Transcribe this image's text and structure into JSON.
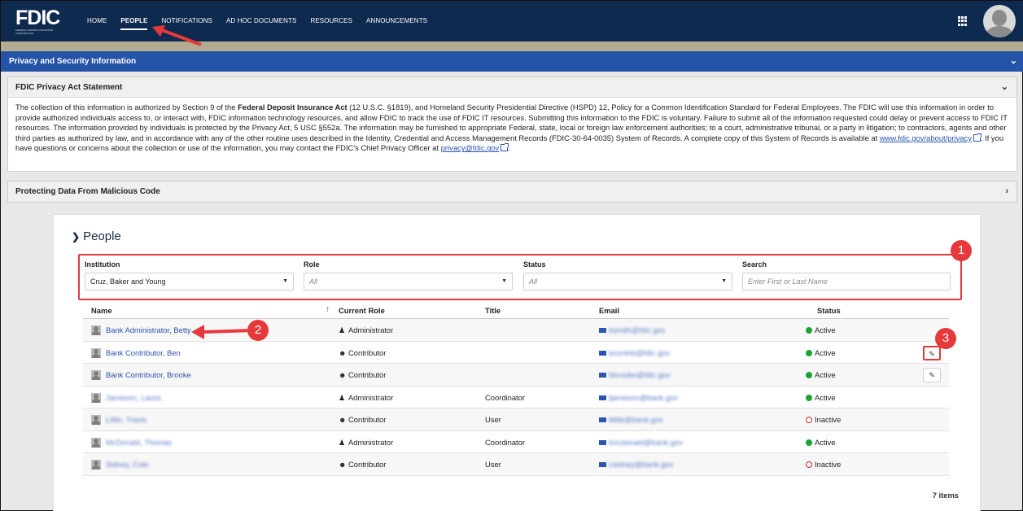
{
  "nav": {
    "logo_text": "FDIC",
    "logo_subtext": "FEDERAL DEPOSIT INSURANCE CORPORATION",
    "items": [
      "HOME",
      "PEOPLE",
      "NOTIFICATIONS",
      "AD HOC DOCUMENTS",
      "RESOURCES",
      "ANNOUNCEMENTS"
    ],
    "active": "PEOPLE"
  },
  "banner": {
    "title": "Privacy and Security Information"
  },
  "privacy": {
    "title": "FDIC Privacy Act Statement",
    "p1": "The collection of this information is authorized by Section 9 of the ",
    "p1_bold": "Federal Deposit Insurance Act",
    "p2": " (12 U.S.C. §1819), and Homeland Security Presidential Directive (HSPD) 12, Policy for a Common Identification Standard for Federal Employees.  The FDIC will use this information in order to provide authorized individuals access to, or interact with, FDIC information technology resources, and allow FDIC to track the use of FDIC IT resources. Submitting this information to the FDIC is voluntary.  Failure to submit all of the information requested could delay or prevent access to FDIC IT resources. The information provided by individuals is protected by the Privacy Act, 5 USC §552a.  The information may be furnished to appropriate Federal, state, local or foreign law enforcement authorities; to a court, administrative tribunal, or a party in litigation; to contractors, agents and other third parties as authorized by law, and in accordance with any of the other routine uses described in the Identity, Credential and Access Management Records (FDIC-30-64-0035) System of Records.  A complete copy of this System of Records is available at ",
    "link1": "www.fdic.gov/about/privacy",
    "p3": ". If you have questions or concerns about the collection or use of the information, you may contact the FDIC's Chief Privacy Officer at ",
    "link2": "privacy@fdic.gov",
    "p4": "."
  },
  "malicious": {
    "title": "Protecting Data From Malicious Code"
  },
  "people": {
    "title": "People",
    "filters": {
      "institution_label": "Institution",
      "institution_value": "Cruz, Baker and Young",
      "role_label": "Role",
      "role_value": "All",
      "status_label": "Status",
      "status_value": "All",
      "search_label": "Search",
      "search_placeholder": "Enter First or Last Name"
    },
    "columns": {
      "name": "Name",
      "role": "Current Role",
      "title": "Title",
      "email": "Email",
      "status": "Status"
    },
    "rows": [
      {
        "name": "Bank Administrator, Betty",
        "role": "Administrator",
        "role_icon": "users-icon",
        "title": "",
        "email": "bsmith@fdic.gov",
        "status": "Active",
        "edit": false,
        "blurred": false
      },
      {
        "name": "Bank Contributor, Ben",
        "role": "Contributor",
        "role_icon": "user-icon",
        "title": "",
        "email": "bcontrib@fdic.gov",
        "status": "Active",
        "edit": true,
        "blurred": false
      },
      {
        "name": "Bank Contributor, Brooke",
        "role": "Contributor",
        "role_icon": "user-icon",
        "title": "",
        "email": "bbrooke@fdic.gov",
        "status": "Active",
        "edit": true,
        "blurred": false
      },
      {
        "name": "Jameson, Laura",
        "role": "Administrator",
        "role_icon": "users-icon",
        "title": "Coordinator",
        "email": "ljameson@bank.gov",
        "status": "Active",
        "edit": false,
        "blurred": true
      },
      {
        "name": "Little, Travis",
        "role": "Contributor",
        "role_icon": "user-icon",
        "title": "User",
        "email": "tlittle@bank.gov",
        "status": "Inactive",
        "edit": false,
        "blurred": true
      },
      {
        "name": "McDonald, Thomas",
        "role": "Administrator",
        "role_icon": "users-icon",
        "title": "Coordinator",
        "email": "tmcdonald@bank.gov",
        "status": "Active",
        "edit": false,
        "blurred": true
      },
      {
        "name": "Sidney, Cole",
        "role": "Contributor",
        "role_icon": "user-icon",
        "title": "User",
        "email": "csidney@bank.gov",
        "status": "Inactive",
        "edit": false,
        "blurred": true
      }
    ],
    "count_label": "7 items"
  },
  "annotations": [
    "1",
    "2",
    "3"
  ],
  "colors": {
    "nav_bg": "#0e2a4e",
    "banner": "#2553a8",
    "khaki": "#b4ac91",
    "annotation": "#e5393b",
    "active": "#1aa532",
    "inactive": "#d0241e",
    "link": "#2a55b0"
  }
}
